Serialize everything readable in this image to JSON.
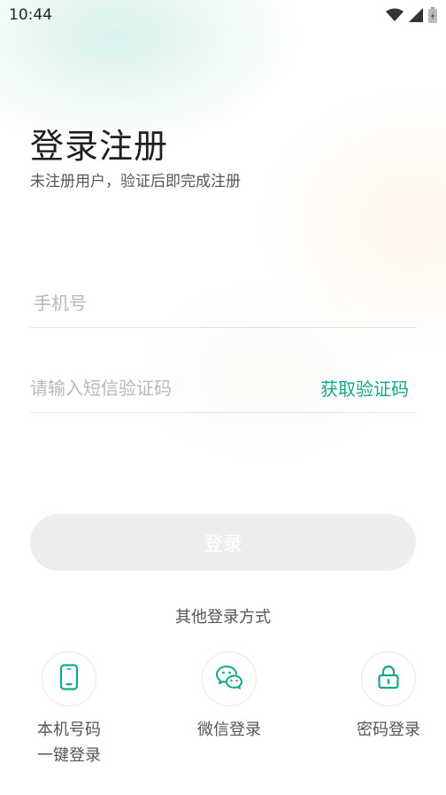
{
  "status_bar": {
    "time": "10:44"
  },
  "login": {
    "title": "登录注册",
    "subtitle": "未注册用户，验证后即完成注册",
    "phone_placeholder": "手机号",
    "code_placeholder": "请输入短信验证码",
    "get_code_label": "获取验证码",
    "login_button": "登录",
    "other_methods_title": "其他登录方式"
  },
  "options": [
    {
      "label_line1": "本机号码",
      "label_line2": "一键登录",
      "icon": "phone-icon"
    },
    {
      "label": "微信登录",
      "icon": "wechat-icon"
    },
    {
      "label": "密码登录",
      "icon": "lock-icon"
    }
  ],
  "colors": {
    "accent": "#12a88a",
    "button_disabled": "#eeeeee"
  }
}
